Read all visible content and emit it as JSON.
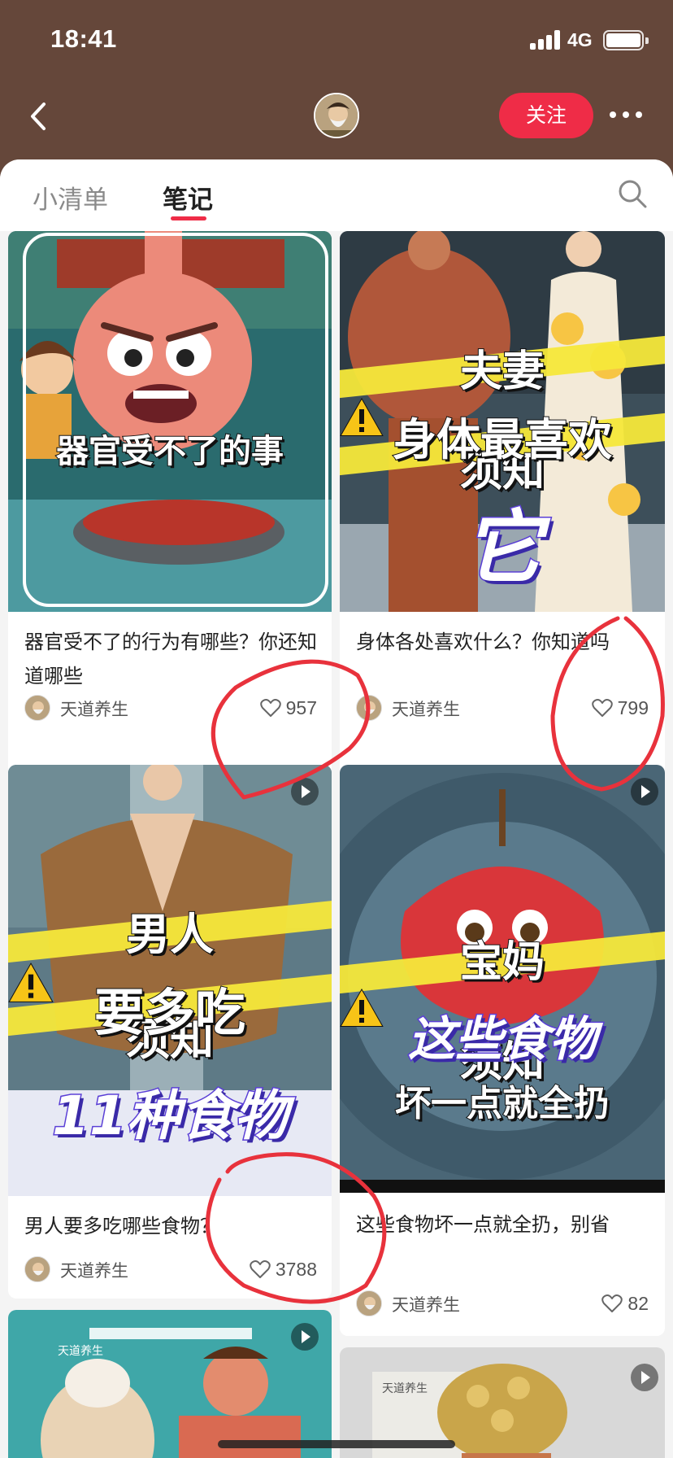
{
  "status_bar": {
    "time": "18:41",
    "network": "4G"
  },
  "nav": {
    "back_icon": "chevron-left-icon",
    "follow_label": "关注",
    "more_icon": "ellipsis-icon"
  },
  "tabs": [
    {
      "label": "小清单",
      "active": false
    },
    {
      "label": "笔记",
      "active": true
    }
  ],
  "search_icon": "search-icon",
  "notes": [
    {
      "cover_text": [
        "器官受不了的事"
      ],
      "title": "器官受不了的行为有哪些？你还知道哪些",
      "author": "天道养生",
      "likes": "957",
      "is_video": false
    },
    {
      "cover_text": [
        "夫妻",
        "须知",
        "身体最喜欢",
        "它"
      ],
      "title": "身体各处喜欢什么？你知道吗",
      "author": "天道养生",
      "likes": "799",
      "is_video": false
    },
    {
      "cover_text": [
        "男人",
        "须知",
        "要多吃",
        "11种食物"
      ],
      "title": "男人要多吃哪些食物？",
      "author": "天道养生",
      "likes": "3788",
      "is_video": true
    },
    {
      "cover_text": [
        "宝妈",
        "须知",
        "这些食物",
        "坏一点就全扔"
      ],
      "title": "这些食物坏一点就全扔，别省",
      "author": "天道养生",
      "likes": "82",
      "is_video": true
    },
    {
      "cover_text": [
        "天道养生"
      ],
      "is_video": true
    },
    {
      "cover_text": [
        "天道养生"
      ],
      "is_video": true
    }
  ],
  "colors": {
    "header_bg": "#65473a",
    "accent": "#ef2c47",
    "annotation": "#e8323c"
  }
}
